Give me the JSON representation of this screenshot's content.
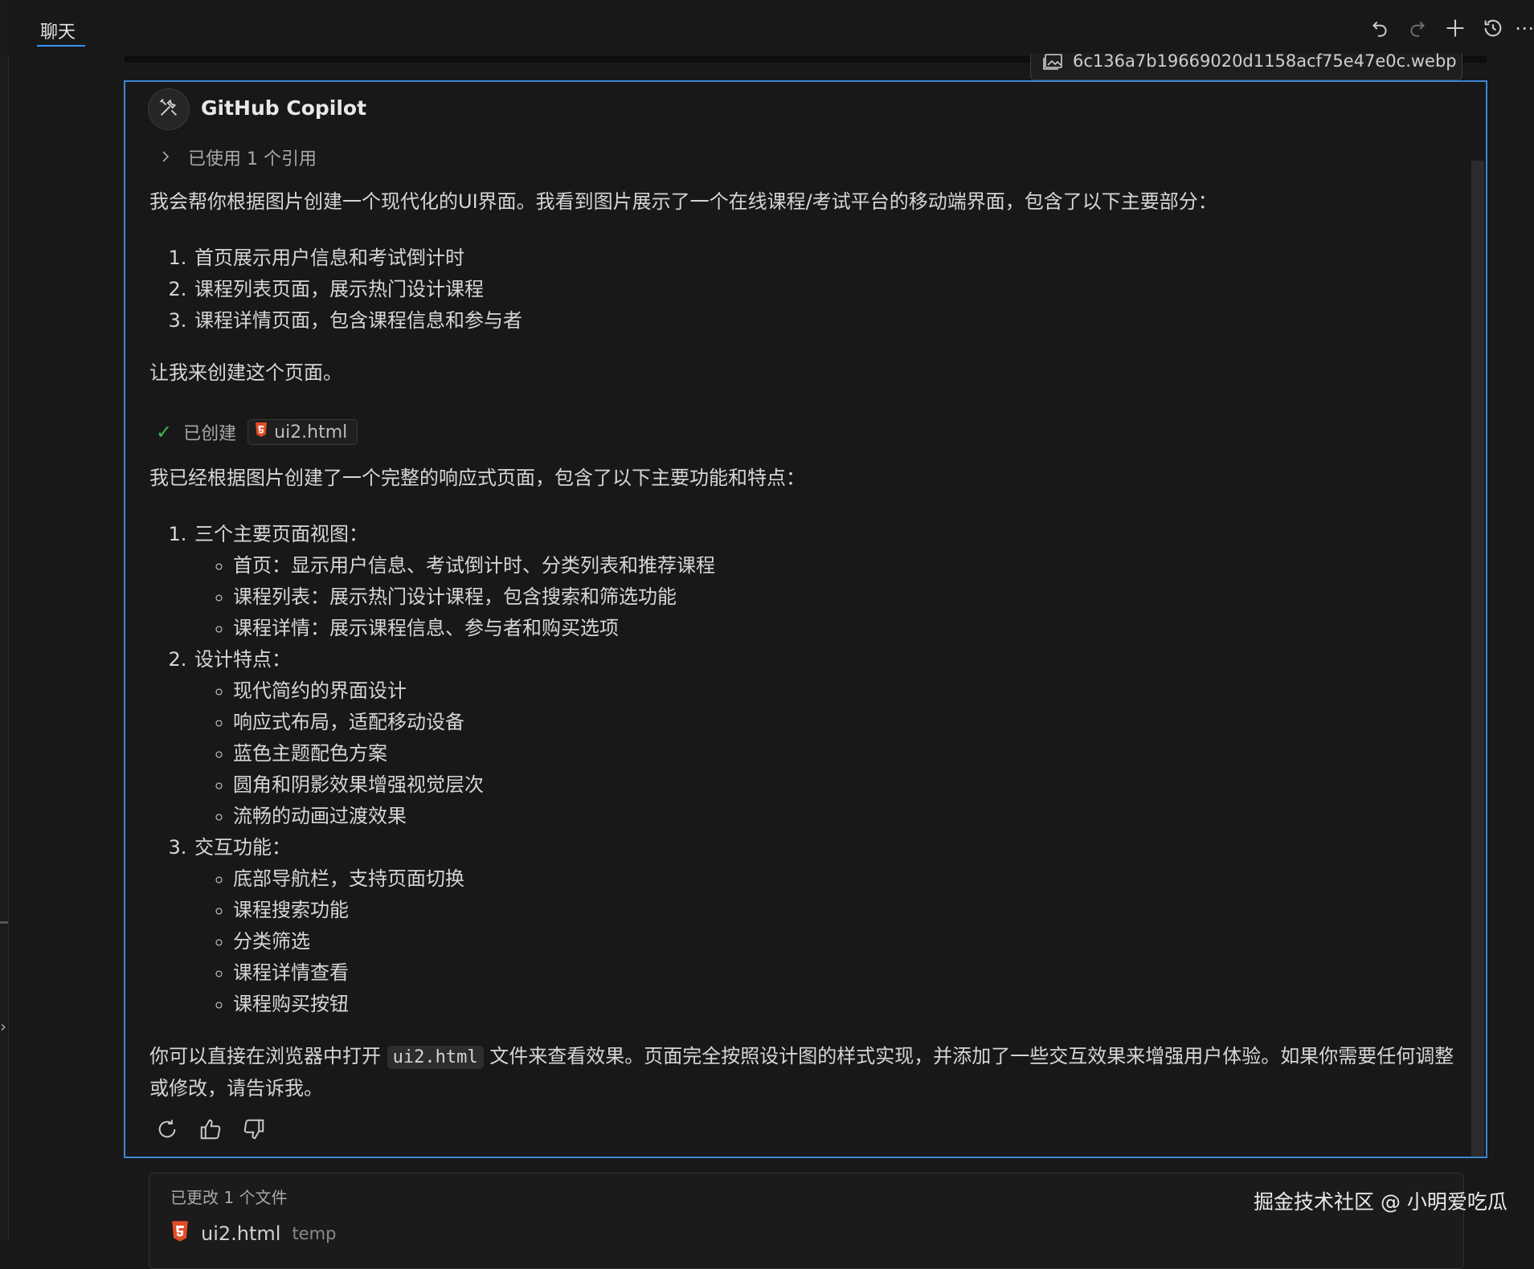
{
  "topbar": {
    "tab_label": "聊天",
    "icons": [
      "undo-icon",
      "redo-icon",
      "add-icon",
      "history-icon",
      "more-icon"
    ]
  },
  "attachment": {
    "file_name": "6c136a7b19669020d1158acf75e47e0c.webp"
  },
  "message": {
    "author": "GitHub Copilot",
    "references_label": "已使用 1 个引用",
    "intro": "我会帮你根据图片创建一个现代化的UI界面。我看到图片展示了一个在线课程/考试平台的移动端界面，包含了以下主要部分：",
    "intro_list": [
      "首页展示用户信息和考试倒计时",
      "课程列表页面，展示热门设计课程",
      "课程详情页面，包含课程信息和参与者"
    ],
    "lead": "让我来创建这个页面。",
    "created_label": "已创建",
    "created_file": "ui2.html",
    "summary": "我已经根据图片创建了一个完整的响应式页面，包含了以下主要功能和特点：",
    "sections": [
      {
        "title": "三个主要页面视图：",
        "items": [
          "首页：显示用户信息、考试倒计时、分类列表和推荐课程",
          "课程列表：展示热门设计课程，包含搜索和筛选功能",
          "课程详情：展示课程信息、参与者和购买选项"
        ]
      },
      {
        "title": "设计特点：",
        "items": [
          "现代简约的界面设计",
          "响应式布局，适配移动设备",
          "蓝色主题配色方案",
          "圆角和阴影效果增强视觉层次",
          "流畅的动画过渡效果"
        ]
      },
      {
        "title": "交互功能：",
        "items": [
          "底部导航栏，支持页面切换",
          "课程搜索功能",
          "分类筛选",
          "课程详情查看",
          "课程购买按钮"
        ]
      }
    ],
    "closing_before": "你可以直接在浏览器中打开",
    "closing_code": "ui2.html",
    "closing_after": "文件来查看效果。页面完全按照设计图的样式实现，并添加了一些交互效果来增强用户体验。如果你需要任何调整或修改，请告诉我。"
  },
  "changes": {
    "title": "已更改 1 个文件",
    "file": "ui2.html",
    "file_tag": "temp"
  },
  "watermark": "掘金技术社区 @ 小明爱吃瓜",
  "colors": {
    "accent": "#3a86d4",
    "check": "#3fb950",
    "html_icon": "#e34c26",
    "background": "#181818"
  }
}
